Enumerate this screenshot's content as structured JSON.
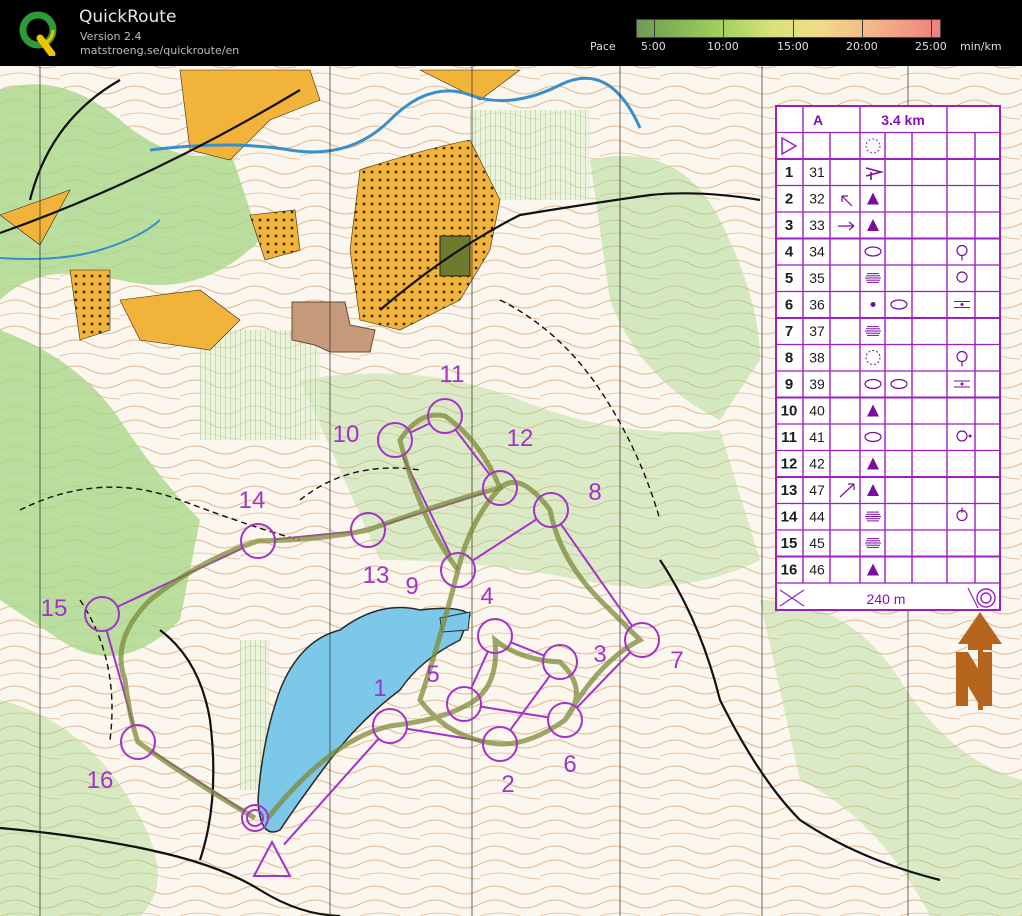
{
  "app": {
    "name": "QuickRoute",
    "version": "Version 2.4",
    "url": "matstroeng.se/quickroute/en"
  },
  "pace_scale": {
    "label": "Pace",
    "ticks": [
      "5:00",
      "10:00",
      "15:00",
      "20:00",
      "25:00"
    ],
    "unit": "min/km"
  },
  "control_description": {
    "class": "A",
    "length": "3.4 km",
    "rows": [
      {
        "num": "1",
        "code": "31"
      },
      {
        "num": "2",
        "code": "32"
      },
      {
        "num": "3",
        "code": "33"
      },
      {
        "num": "4",
        "code": "34"
      },
      {
        "num": "5",
        "code": "35"
      },
      {
        "num": "6",
        "code": "36"
      },
      {
        "num": "7",
        "code": "37"
      },
      {
        "num": "8",
        "code": "38"
      },
      {
        "num": "9",
        "code": "39"
      },
      {
        "num": "10",
        "code": "40"
      },
      {
        "num": "11",
        "code": "41"
      },
      {
        "num": "12",
        "code": "42"
      },
      {
        "num": "13",
        "code": "47"
      },
      {
        "num": "14",
        "code": "44"
      },
      {
        "num": "15",
        "code": "45"
      },
      {
        "num": "16",
        "code": "46"
      }
    ],
    "finish_distance": "240 m"
  },
  "course_labels": [
    "1",
    "2",
    "3",
    "4",
    "5",
    "6",
    "7",
    "8",
    "9",
    "10",
    "11",
    "12",
    "13",
    "14",
    "15",
    "16"
  ],
  "colors": {
    "course": "#a333c8",
    "water": "#7cc8e8",
    "open_land": "#f5b63a",
    "forest_green": "#9fd27a",
    "contour": "#b8773a",
    "north_arrow": "#b5651d"
  }
}
